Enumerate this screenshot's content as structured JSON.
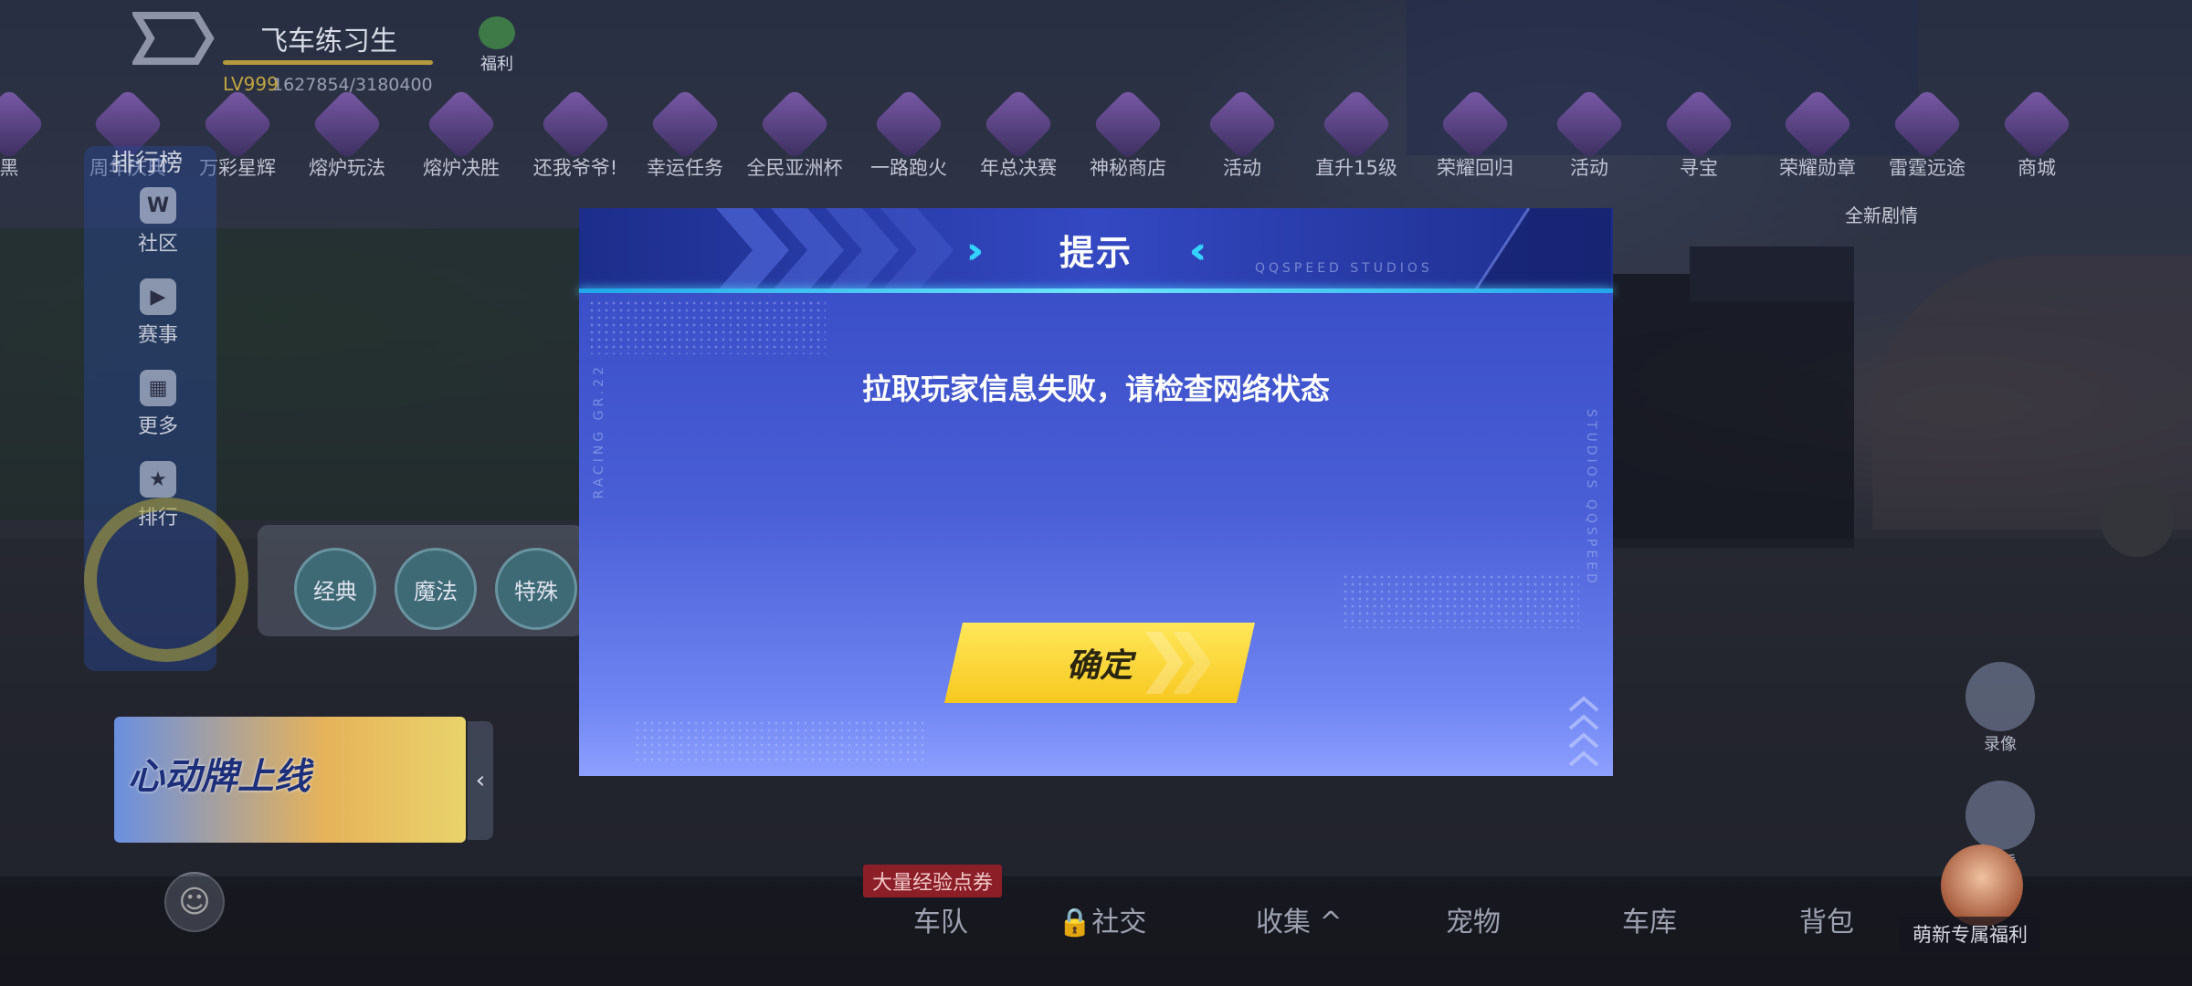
{
  "player": {
    "name": "飞车练习生",
    "level": "LV999",
    "xp": "1627854/3180400"
  },
  "welfare_label": "福利",
  "top_events": [
    {
      "label": "黑"
    },
    {
      "label": "周年庆典"
    },
    {
      "label": "万彩星辉"
    },
    {
      "label": "熔炉玩法"
    },
    {
      "label": "熔炉决胜"
    },
    {
      "label": "还我爷爷!"
    },
    {
      "label": "幸运任务"
    },
    {
      "label": "全民亚洲杯"
    },
    {
      "label": "一路跑火"
    },
    {
      "label": "年总决赛"
    },
    {
      "label": "神秘商店"
    },
    {
      "label": "活动"
    },
    {
      "label": "直升15级"
    },
    {
      "label": "荣耀回归"
    },
    {
      "label": "活动"
    },
    {
      "label": "寻宝"
    },
    {
      "label": "荣耀勋章"
    },
    {
      "label": "雷霆远途"
    },
    {
      "label": "商城"
    }
  ],
  "top_event_sub": "全新剧情",
  "leaderboard_label": "排行榜",
  "left_sidebar": [
    {
      "label": "社区",
      "icon": "W"
    },
    {
      "label": "赛事",
      "icon": "▶"
    },
    {
      "label": "更多",
      "icon": "▦"
    },
    {
      "label": "排行",
      "icon": "★"
    }
  ],
  "game_modes": [
    "经典",
    "魔法",
    "特殊"
  ],
  "banner_text": "心动牌上线",
  "bottom_nav": {
    "promo": "大量经验点券",
    "items": [
      "车队",
      "社交",
      "收集",
      "宠物",
      "车库",
      "背包"
    ],
    "collect_arrow": "^"
  },
  "right_buttons": [
    {
      "label": "录像"
    },
    {
      "label": "观看"
    }
  ],
  "new_gift": "萌新专属福利",
  "dialog": {
    "title": "提示",
    "message": "拉取玩家信息失败，请检查网络状态",
    "confirm_label": "确定",
    "brand_text": "QQSPEED STUDIOS",
    "left_vertical": "RACING GR.22",
    "right_vertical": "STUDIOS QQSPEED"
  },
  "colors": {
    "dialog_header": "#1c2d8a",
    "dialog_body": "#4a5fd6",
    "accent_cyan": "#35d3ff",
    "confirm_yellow": "#fbd83a"
  }
}
